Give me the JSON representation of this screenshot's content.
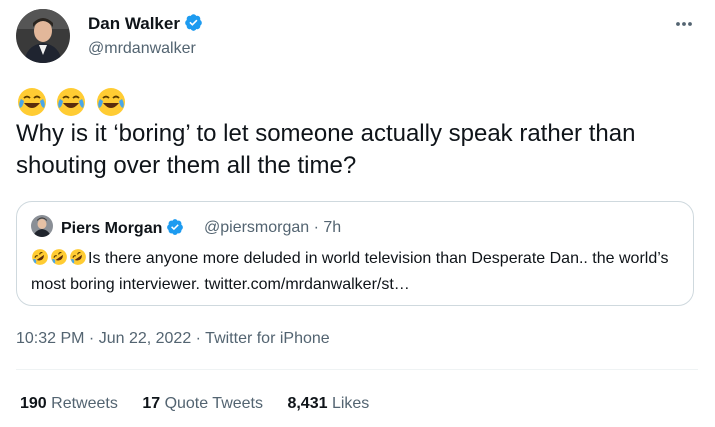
{
  "author": {
    "name": "Dan Walker",
    "handle": "@mrdanwalker"
  },
  "tweet": {
    "emojis": [
      "😂",
      "😂",
      "😂"
    ],
    "text": "Why is it ‘boring’ to let someone actually speak rather than shouting over them all the time?"
  },
  "quote": {
    "name": "Piers Morgan",
    "handle_time": "@piersmorgan · 7h",
    "emojis": [
      "🤣",
      "🤣",
      "🤣"
    ],
    "text": "Is there anyone more deluded in world television than Desperate Dan.. the world’s most boring interviewer. twitter.com/mrdanwalker/st…"
  },
  "meta": {
    "time": "10:32 PM",
    "date": "Jun 22, 2022",
    "source": "Twitter for iPhone",
    "separator": " · "
  },
  "stats": [
    {
      "count": "190",
      "label": "Retweets"
    },
    {
      "count": "17",
      "label": "Quote Tweets"
    },
    {
      "count": "8,431",
      "label": "Likes"
    }
  ],
  "colors": {
    "verified": "#1d9bf0",
    "secondary_text": "#536471",
    "border": "#cfd9de"
  },
  "icons": {
    "verified": "verified-badge-icon",
    "more": "more-horizontal-icon"
  }
}
